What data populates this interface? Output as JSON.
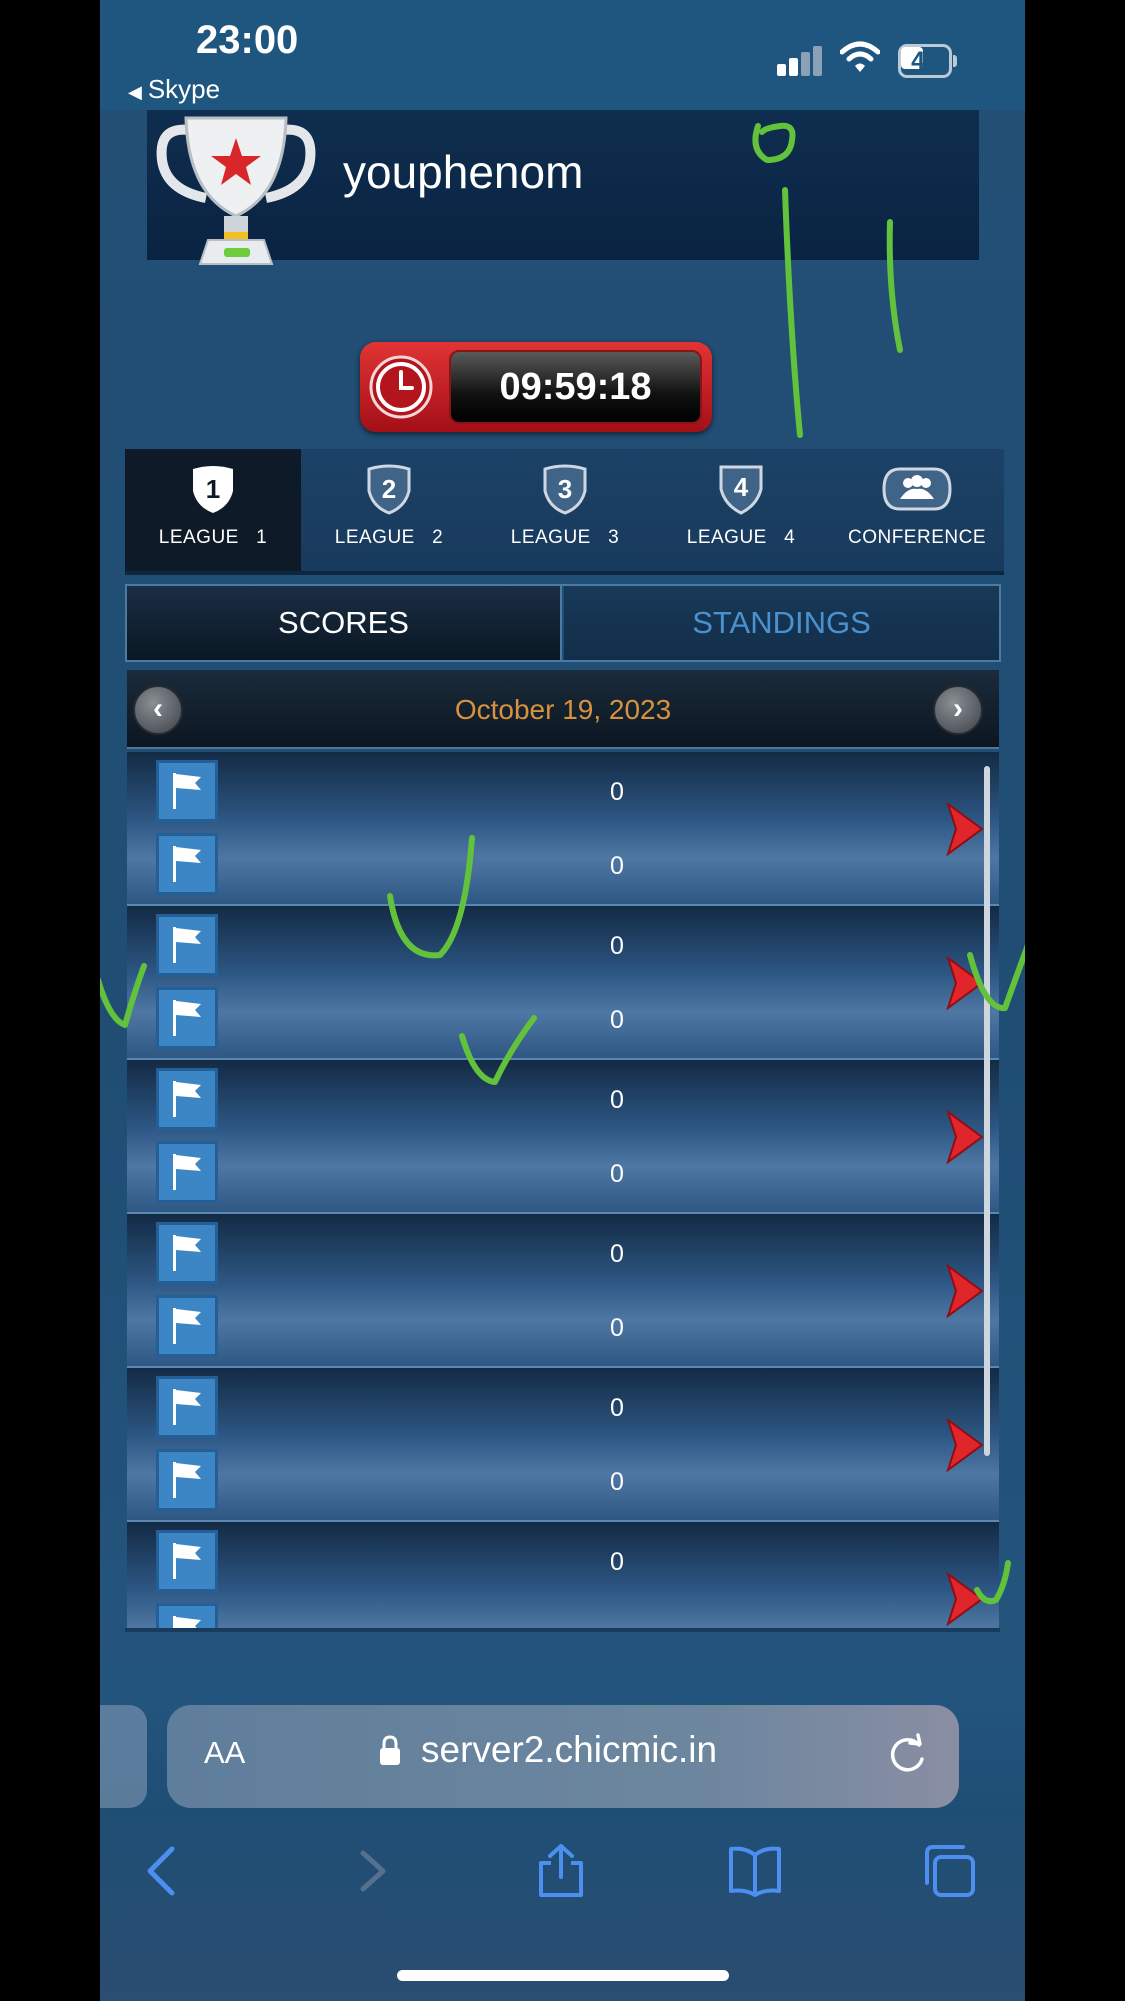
{
  "status_bar": {
    "time": "23:00",
    "back_app": "Skype",
    "battery": "47"
  },
  "header": {
    "username": "youphenom"
  },
  "timer": {
    "value": "09:59:18"
  },
  "league_tabs": [
    {
      "number": "1",
      "label": "LEAGUE   1",
      "active": true
    },
    {
      "number": "2",
      "label": "LEAGUE   2",
      "active": false
    },
    {
      "number": "3",
      "label": "LEAGUE   3",
      "active": false
    },
    {
      "number": "4",
      "label": "LEAGUE   4",
      "active": false
    },
    {
      "number": "",
      "label": "CONFERENCE",
      "active": false
    }
  ],
  "segments": {
    "scores": "SCORES",
    "standings": "STANDINGS",
    "selected": "scores"
  },
  "date_bar": {
    "date": "October 19, 2023"
  },
  "games": [
    {
      "score_top": "0",
      "score_bottom": "0"
    },
    {
      "score_top": "0",
      "score_bottom": "0"
    },
    {
      "score_top": "0",
      "score_bottom": "0"
    },
    {
      "score_top": "0",
      "score_bottom": "0"
    },
    {
      "score_top": "0",
      "score_bottom": "0"
    },
    {
      "score_top": "0",
      "score_bottom": ""
    }
  ],
  "browser": {
    "text_size_label": "AA",
    "url": "server2.chicmic.in"
  },
  "colors": {
    "accent_date": "#d8923e",
    "standings_text": "#4a92cf",
    "timer_red": "#c8202a",
    "annotation_green": "#63c23c"
  },
  "icons": {
    "trophy": "trophy-icon",
    "clock": "clock-icon",
    "flag": "flag-icon",
    "chevron_right": "chevron-right-icon",
    "conference": "conference-icon"
  }
}
